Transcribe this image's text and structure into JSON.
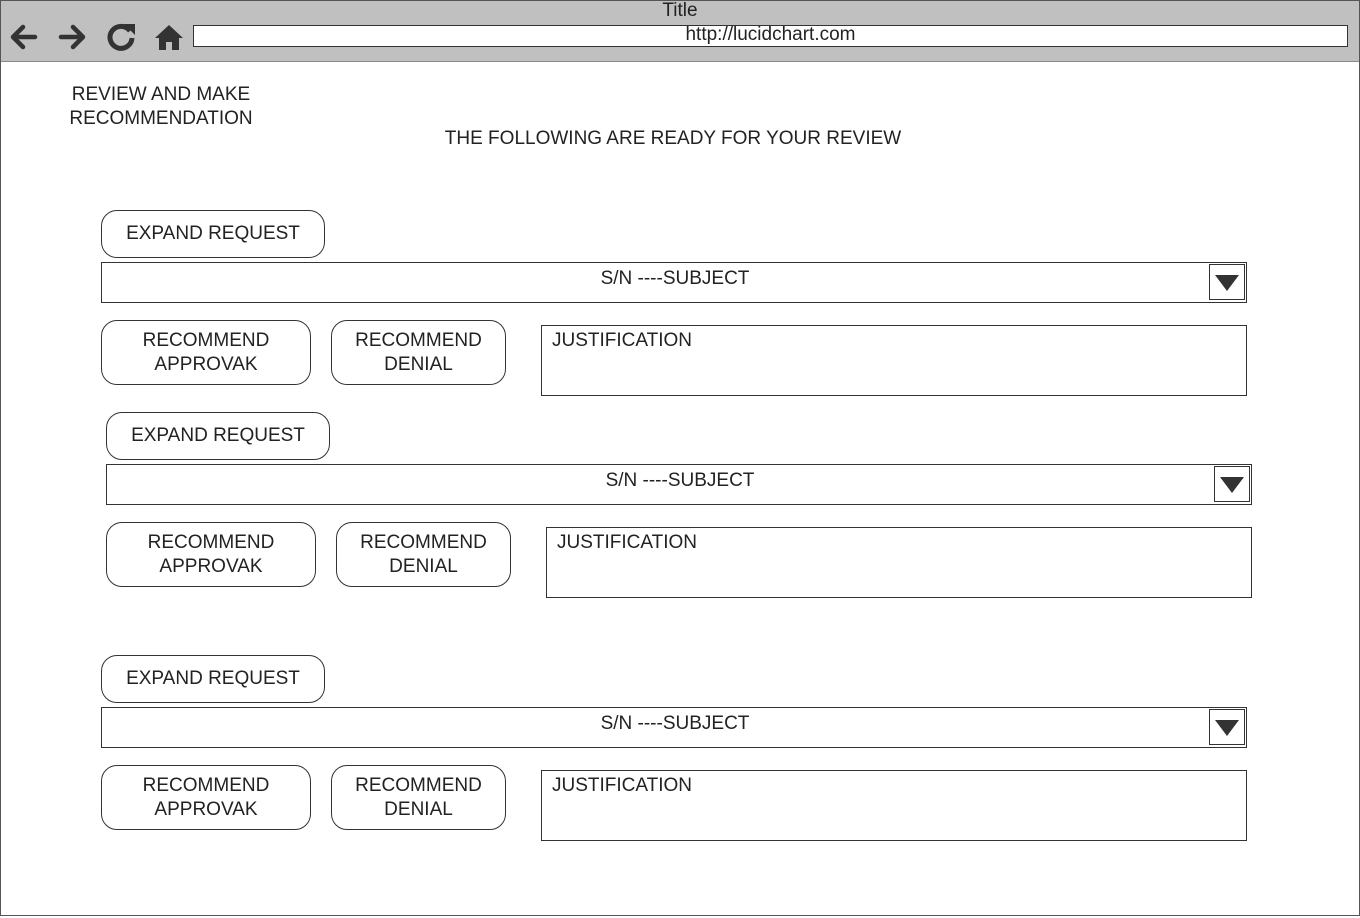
{
  "browser": {
    "title": "Title",
    "url": "http://lucidchart.com"
  },
  "page": {
    "heading": "REVIEW AND MAKE RECOMMENDATION",
    "subheading": "THE FOLLOWING ARE READY FOR YOUR REVIEW"
  },
  "requests": [
    {
      "expand_label": "EXPAND REQUEST",
      "subject": "S/N ----SUBJECT",
      "approve_label": "RECOMMEND APPROVAK",
      "deny_label": "RECOMMEND DENIAL",
      "justification_label": "JUSTIFICATION"
    },
    {
      "expand_label": "EXPAND REQUEST",
      "subject": "S/N ----SUBJECT",
      "approve_label": "RECOMMEND APPROVAK",
      "deny_label": "RECOMMEND DENIAL",
      "justification_label": "JUSTIFICATION"
    },
    {
      "expand_label": "EXPAND REQUEST",
      "subject": "S/N ----SUBJECT",
      "approve_label": "RECOMMEND APPROVAK",
      "deny_label": "RECOMMEND DENIAL",
      "justification_label": "JUSTIFICATION"
    }
  ],
  "icons": {
    "back": "arrow-left-icon",
    "forward": "arrow-right-icon",
    "reload": "reload-icon",
    "home": "home-icon",
    "dropdown": "caret-down-icon"
  },
  "colors": {
    "chrome": "#c0c0c0",
    "icon": "#333333",
    "border": "#333333"
  }
}
